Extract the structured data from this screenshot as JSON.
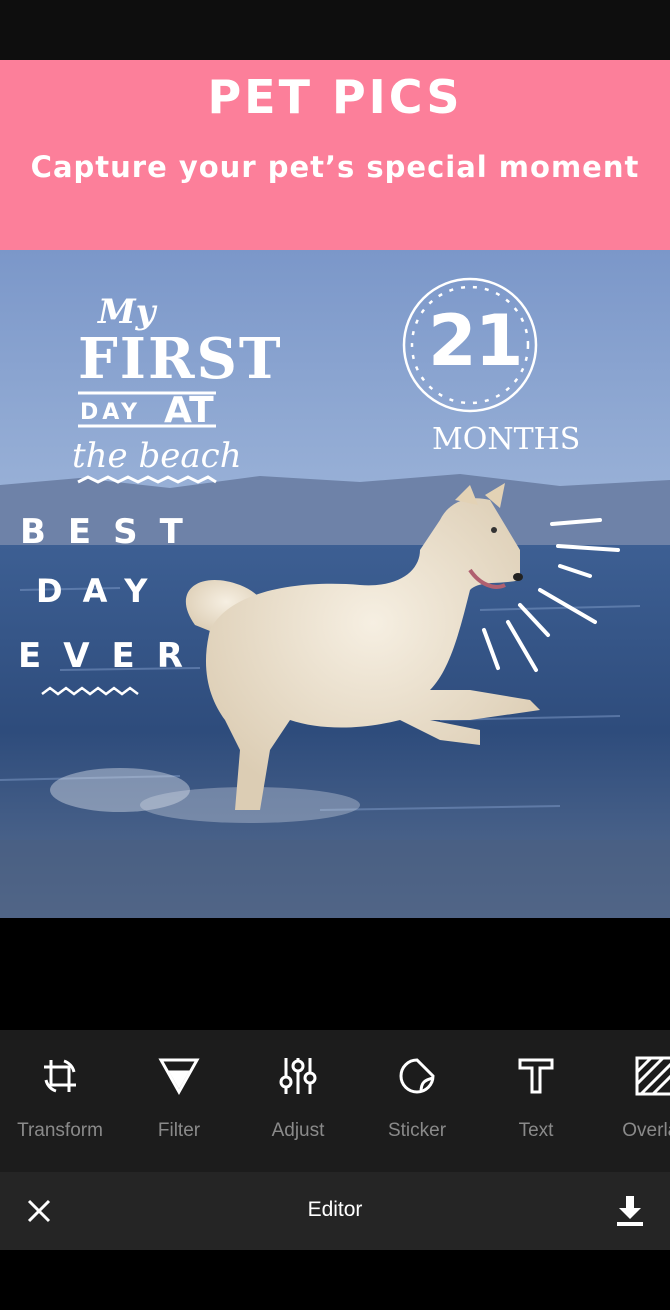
{
  "banner": {
    "title": "PET PICS",
    "subtitle": "Capture your pet’s special moment",
    "color": "#fc7f9a"
  },
  "photo": {
    "stickers": {
      "first_day": {
        "line1": "My",
        "line2": "FIRST",
        "line3_a": "DAY",
        "line3_b": "AT",
        "line4": "the beach"
      },
      "months": {
        "number": "21",
        "label": "MONTHS"
      },
      "best_day": {
        "line1": "BEST",
        "line2": "DAY",
        "line3": "EVER"
      }
    }
  },
  "toolbar": {
    "tools": [
      {
        "label": "Transform",
        "icon": "crop-rotate-icon"
      },
      {
        "label": "Filter",
        "icon": "filter-triangle-icon"
      },
      {
        "label": "Adjust",
        "icon": "sliders-icon"
      },
      {
        "label": "Sticker",
        "icon": "sticker-icon"
      },
      {
        "label": "Text",
        "icon": "text-icon"
      },
      {
        "label": "Overlay",
        "icon": "overlay-icon"
      }
    ]
  },
  "bottom_bar": {
    "title": "Editor",
    "close_icon": "close-icon",
    "download_icon": "download-icon"
  }
}
